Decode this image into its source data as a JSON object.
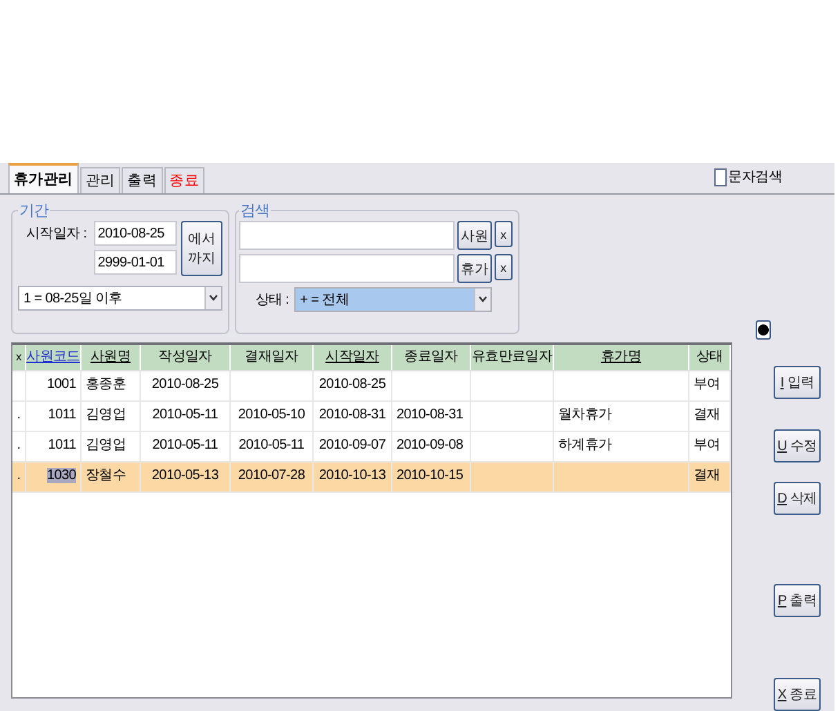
{
  "tabs": [
    {
      "label": "휴가관리",
      "selected": true,
      "color": "#000000"
    },
    {
      "label": "관리",
      "selected": false,
      "color": "#000000"
    },
    {
      "label": "출력",
      "selected": false,
      "color": "#000000"
    },
    {
      "label": "종료",
      "selected": false,
      "color": "#ff0000"
    }
  ],
  "text_search": {
    "label": "문자검색",
    "checked": false
  },
  "period": {
    "title": "기간",
    "start_label": "시작일자 :",
    "from": "2010-08-25",
    "to": "2999-01-01",
    "range_button": [
      "에서",
      "까지"
    ],
    "preset": "1 = 08-25일 이후"
  },
  "search": {
    "title": "검색",
    "employee_button": "사원",
    "vacation_button": "휴가",
    "clear_buttons": [
      "x",
      "x"
    ],
    "status_label": "상태 :",
    "status_value": "+ = 전체"
  },
  "table": {
    "marker_header": "x",
    "columns": [
      {
        "label": "사원코드",
        "underlined": true,
        "selected": true
      },
      {
        "label": "사원명",
        "underlined": true,
        "selected": false
      },
      {
        "label": "작성일자",
        "underlined": false,
        "selected": false
      },
      {
        "label": "결재일자",
        "underlined": false,
        "selected": false
      },
      {
        "label": "시작일자",
        "underlined": true,
        "selected": false
      },
      {
        "label": "종료일자",
        "underlined": false,
        "selected": false
      },
      {
        "label": "유효만료일자",
        "underlined": false,
        "selected": false
      },
      {
        "label": "휴가명",
        "underlined": true,
        "selected": false
      },
      {
        "label": "상태",
        "underlined": false,
        "selected": false
      }
    ],
    "rows": [
      {
        "marker": "",
        "selected": false,
        "cells": [
          "1001",
          "홍종훈",
          "2010-08-25",
          "",
          "2010-08-25",
          "",
          "",
          "",
          "부여"
        ]
      },
      {
        "marker": ".",
        "selected": false,
        "cells": [
          "1011",
          "김영업",
          "2010-05-11",
          "2010-05-10",
          "2010-08-31",
          "2010-08-31",
          "",
          "월차휴가",
          "결재"
        ]
      },
      {
        "marker": ".",
        "selected": false,
        "cells": [
          "1011",
          "김영업",
          "2010-05-11",
          "2010-05-11",
          "2010-09-07",
          "2010-09-08",
          "",
          "하계휴가",
          "부여"
        ]
      },
      {
        "marker": ".",
        "selected": true,
        "cells": [
          "1030",
          "장철수",
          "2010-05-13",
          "2010-07-28",
          "2010-10-13",
          "2010-10-15",
          "",
          "",
          "결재"
        ]
      }
    ]
  },
  "actions": [
    {
      "key": "I",
      "label": "입력"
    },
    {
      "key": "U",
      "label": "수정"
    },
    {
      "key": "D",
      "label": "삭제"
    },
    {
      "key": "P",
      "label": "출력"
    },
    {
      "key": "X",
      "label": "종료"
    }
  ]
}
